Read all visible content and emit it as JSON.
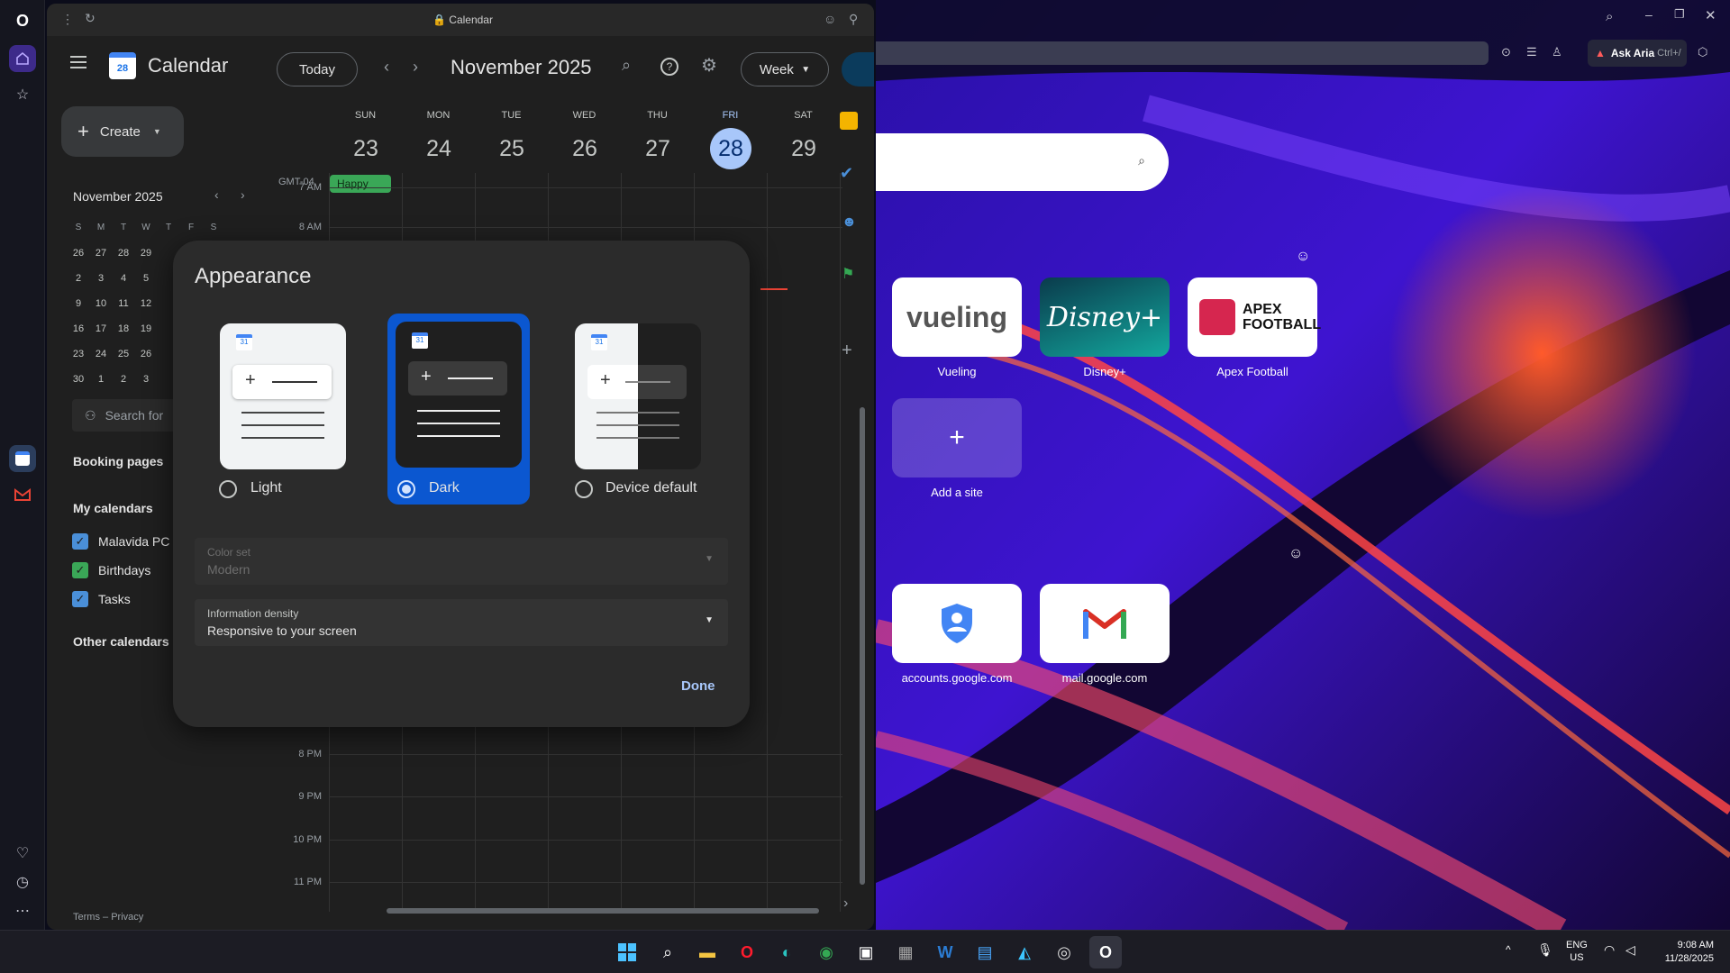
{
  "calendar_tab": {
    "title": "Calendar"
  },
  "header": {
    "app_name": "Calendar",
    "logo_day": "28",
    "today_label": "Today",
    "period": "November 2025",
    "view_label": "Week"
  },
  "create_label": "Create",
  "mini_calendar": {
    "month": "November 2025",
    "weekdays": [
      "S",
      "M",
      "T",
      "W",
      "T",
      "F",
      "S"
    ],
    "rows": [
      [
        "26",
        "27",
        "28",
        "29"
      ],
      [
        "2",
        "3",
        "4",
        "5"
      ],
      [
        "9",
        "10",
        "11",
        "12"
      ],
      [
        "16",
        "17",
        "18",
        "19"
      ],
      [
        "23",
        "24",
        "25",
        "26"
      ],
      [
        "30",
        "1",
        "2",
        "3"
      ]
    ]
  },
  "search_people": "Search for",
  "booking_pages": "Booking pages",
  "my_calendars": {
    "title": "My calendars",
    "items": [
      {
        "label": "Malavida PC",
        "color": "#4a8fd8"
      },
      {
        "label": "Birthdays",
        "color": "#3aa757"
      },
      {
        "label": "Tasks",
        "color": "#4a8fd8"
      }
    ]
  },
  "other_calendars": "Other calendars",
  "footer": {
    "terms": "Terms",
    "sep": "–",
    "privacy": "Privacy"
  },
  "week": {
    "days": [
      {
        "name": "SUN",
        "num": "23"
      },
      {
        "name": "MON",
        "num": "24"
      },
      {
        "name": "TUE",
        "num": "25"
      },
      {
        "name": "WED",
        "num": "26"
      },
      {
        "name": "THU",
        "num": "27"
      },
      {
        "name": "FRI",
        "num": "28",
        "today": true
      },
      {
        "name": "SAT",
        "num": "29"
      }
    ],
    "timezone": "GMT-04",
    "event": "Happy",
    "hours_top": [
      "7 AM",
      "8 AM"
    ],
    "hours_bottom": [
      "8 PM",
      "9 PM",
      "10 PM",
      "11 PM"
    ]
  },
  "dialog": {
    "title": "Appearance",
    "options": [
      {
        "label": "Light"
      },
      {
        "label": "Dark",
        "selected": true
      },
      {
        "label": "Device default"
      }
    ],
    "logo_day": "31",
    "color_set": {
      "label": "Color set",
      "value": "Modern"
    },
    "density": {
      "label": "Information density",
      "value": "Responsive to your screen"
    },
    "done": "Done"
  },
  "browser": {
    "ask_aria": "Ask Aria",
    "ask_aria_shortcut": "Ctrl+/",
    "tiles": [
      {
        "label": "Vueling",
        "logo": "vueling"
      },
      {
        "label": "Disney+",
        "logo": "Disney+"
      },
      {
        "label": "Apex Football",
        "logo": "APEX FOOTBALL"
      },
      {
        "label": "Add a site"
      },
      {
        "label": "accounts.google.com"
      },
      {
        "label": "mail.google.com"
      }
    ]
  },
  "taskbar": {
    "lang": "ENG",
    "region": "US",
    "time": "9:08 AM",
    "date": "11/28/2025"
  },
  "colors": {
    "accent": "#8ab4f8",
    "dialog_selected": "#0b57d0",
    "today_circle": "#a8c7fa"
  }
}
